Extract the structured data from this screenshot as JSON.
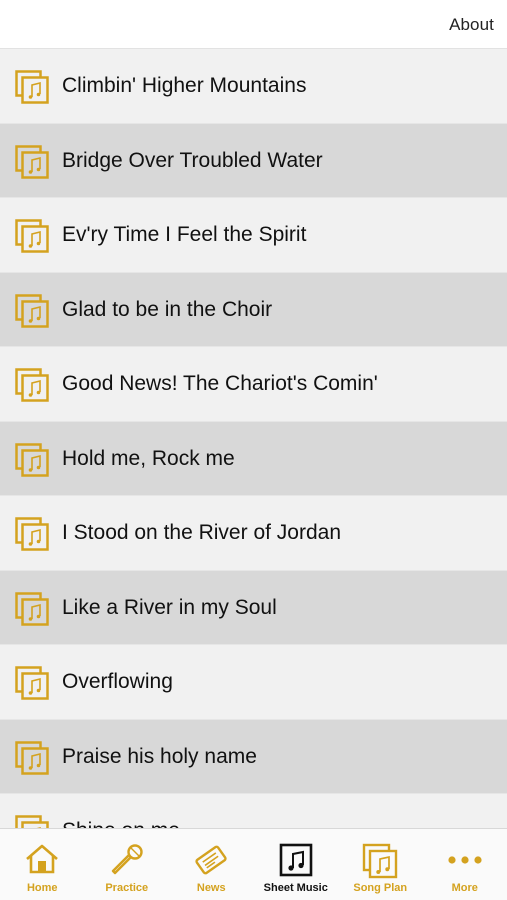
{
  "header": {
    "about_label": "About"
  },
  "songs": [
    "Climbin' Higher Mountains",
    "Bridge Over Troubled Water",
    "Ev'ry Time I Feel the Spirit",
    "Glad to be in the Choir",
    "Good News! The Chariot's Comin'",
    "Hold me, Rock me",
    "I Stood on the River of Jordan",
    "Like a River in my Soul",
    "Overflowing",
    "Praise his holy name",
    "Shine on me"
  ],
  "tabs": [
    {
      "label": "Home",
      "icon": "home-icon"
    },
    {
      "label": "Practice",
      "icon": "microphone-icon"
    },
    {
      "label": "News",
      "icon": "ticket-icon"
    },
    {
      "label": "Sheet Music",
      "icon": "music-note-icon",
      "active": true
    },
    {
      "label": "Song Plan",
      "icon": "song-plan-icon"
    },
    {
      "label": "More",
      "icon": "more-dots-icon"
    }
  ],
  "colors": {
    "accent": "#d4a21f",
    "active_tab": "#111111",
    "row_light": "#f1f1f1",
    "row_dark": "#d8d8d8"
  }
}
